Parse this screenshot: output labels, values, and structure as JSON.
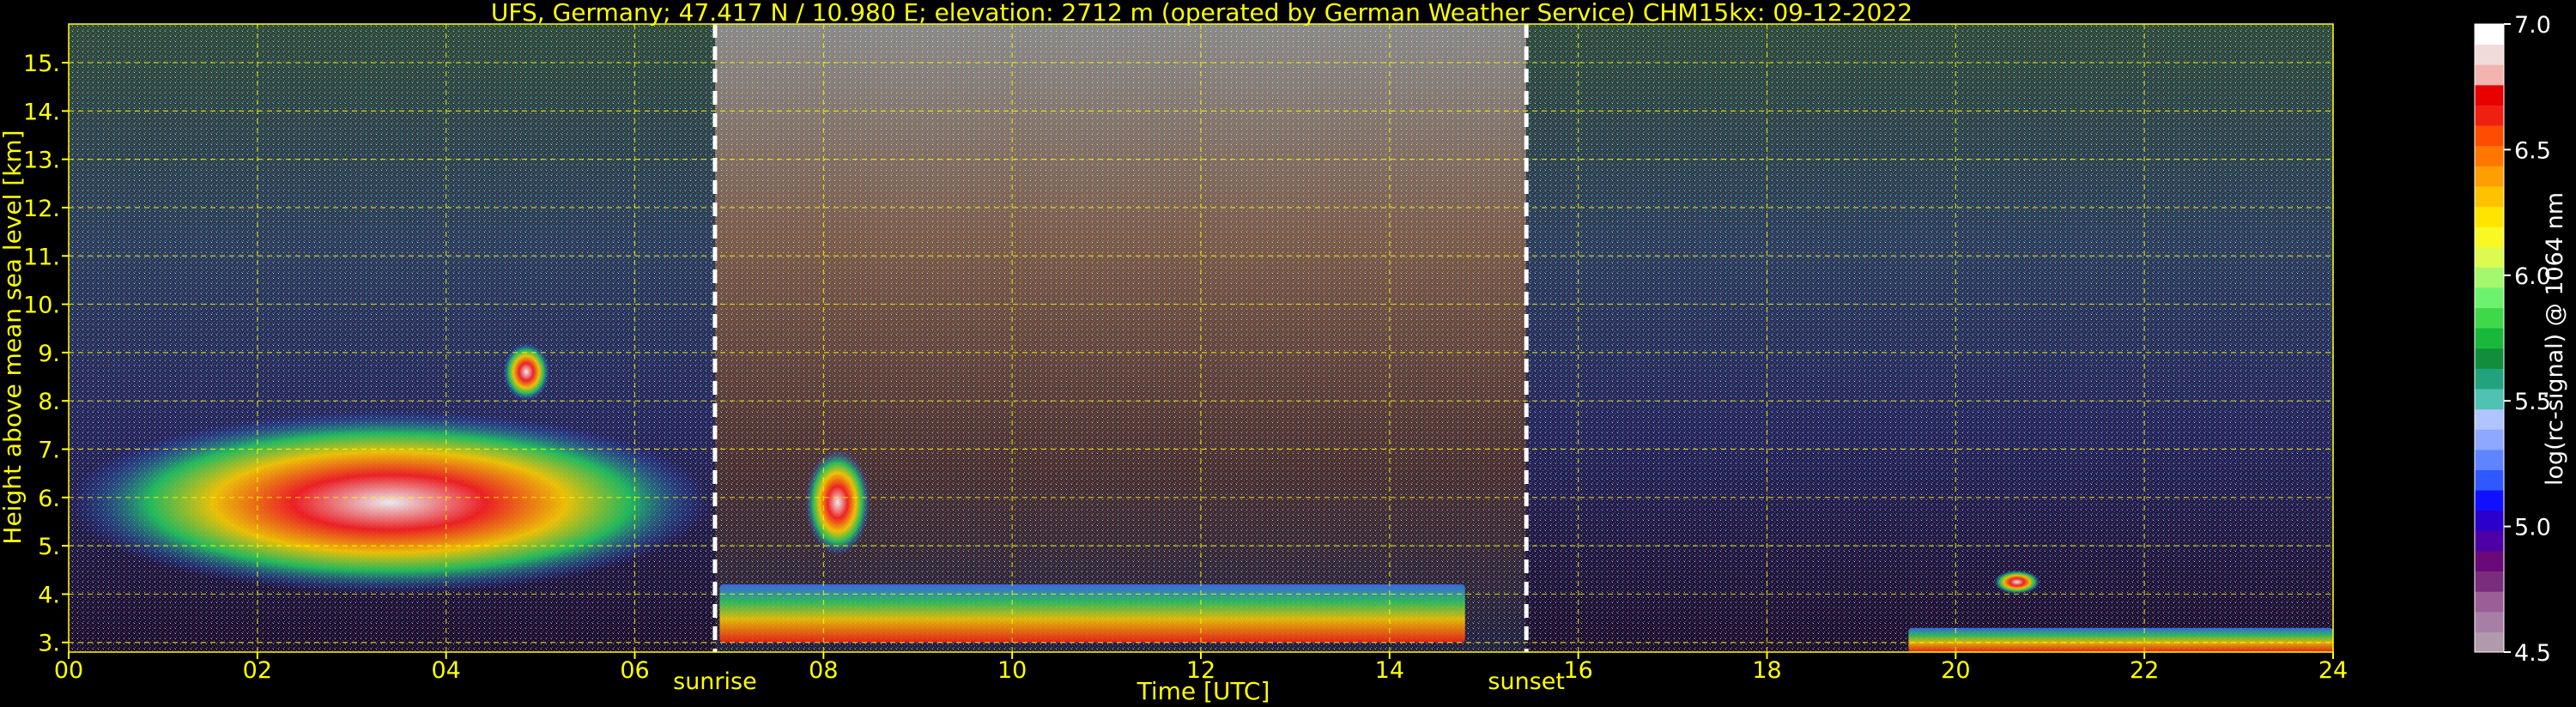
{
  "chart_data": {
    "type": "heatmap",
    "title": "UFS, Germany; 47.417 N / 10.980 E; elevation: 2712 m  (operated by German Weather Service)    CHM15kx: 09-12-2022",
    "xlabel": "Time [UTC]",
    "ylabel": "Height above mean sea level [km]",
    "xlim": [
      0,
      24
    ],
    "ylim": [
      2.8,
      15.8
    ],
    "x_ticks": [
      "00",
      "02",
      "04",
      "06",
      "08",
      "10",
      "12",
      "14",
      "16",
      "18",
      "20",
      "22",
      "24"
    ],
    "y_ticks": [
      "3.",
      "4.",
      "5.",
      "6.",
      "7.",
      "8.",
      "9.",
      "10.",
      "11.",
      "12.",
      "13.",
      "14.",
      "15."
    ],
    "grid": true,
    "markers": [
      {
        "label": "sunrise",
        "x": 6.85
      },
      {
        "label": "sunset",
        "x": 15.45
      }
    ],
    "colorbar": {
      "label": "log(rc-signal) @ 1064 nm",
      "range": [
        4.5,
        7.0
      ],
      "ticks": [
        "4.5",
        "5.0",
        "5.5",
        "6.0",
        "6.5",
        "7.0"
      ],
      "colors": [
        "#b09aac",
        "#a77fa4",
        "#9a5f96",
        "#7a2d7c",
        "#6a0a78",
        "#4d00a6",
        "#2a00cc",
        "#1010ff",
        "#3058ff",
        "#5f84ff",
        "#8ea8ff",
        "#b0c4ff",
        "#4fc2b2",
        "#22a37e",
        "#118e3c",
        "#1ab83a",
        "#3fd84b",
        "#6cf26f",
        "#a3f86d",
        "#dcfa50",
        "#f8f823",
        "#ffe400",
        "#ffc200",
        "#ff9e00",
        "#ff7700",
        "#ff4d00",
        "#f02010",
        "#e80000",
        "#f3b4b0",
        "#f1dada",
        "#ffffff"
      ]
    },
    "features": [
      {
        "name": "boundary layer aerosol",
        "x": [
          6.9,
          14.8
        ],
        "y": [
          3.0,
          4.2
        ],
        "value": 6.3
      },
      {
        "name": "cloud layer",
        "x": [
          0.0,
          6.8
        ],
        "y": [
          4.0,
          7.8
        ],
        "value": 6.6
      },
      {
        "name": "cloud",
        "x": [
          4.6,
          5.1
        ],
        "y": [
          8.0,
          9.2
        ],
        "value": 6.4
      },
      {
        "name": "cloud",
        "x": [
          7.8,
          8.5
        ],
        "y": [
          4.8,
          7.0
        ],
        "value": 6.4
      },
      {
        "name": "cloud",
        "x": [
          20.4,
          20.9
        ],
        "y": [
          4.0,
          4.5
        ],
        "value": 6.8
      },
      {
        "name": "ground layer",
        "x": [
          19.5,
          24.0
        ],
        "y": [
          2.8,
          3.3
        ],
        "value": 6.9
      }
    ]
  }
}
